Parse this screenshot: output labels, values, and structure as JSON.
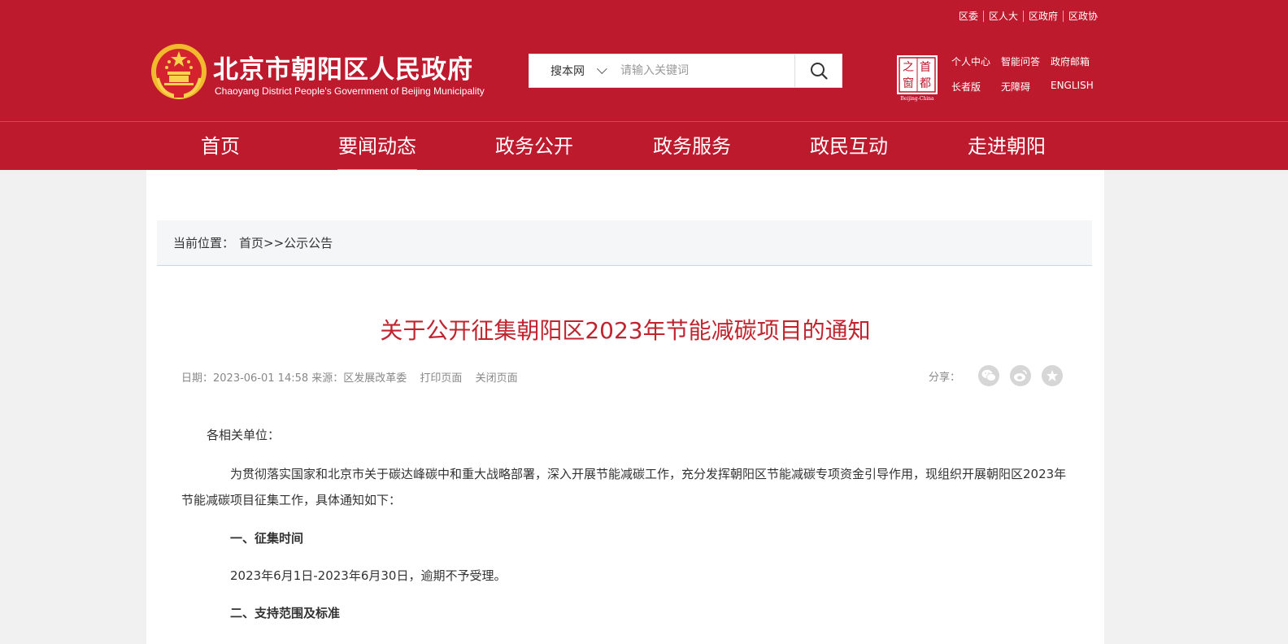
{
  "top_links": [
    "区委",
    "区人大",
    "区政府",
    "区政协"
  ],
  "site": {
    "title": "北京市朝阳区人民政府",
    "subtitle": "Chaoyang District People's Government of Beijing Municipality"
  },
  "search": {
    "scope": "搜本网",
    "placeholder": "请输入关键词"
  },
  "capital_logo": {
    "text_a": "首",
    "text_b": "都",
    "text_c": "之",
    "text_d": "窗",
    "caption": "Beijing-China"
  },
  "quick_links": {
    "row1": [
      "个人中心",
      "智能问答",
      "政府邮箱"
    ],
    "row2": [
      "长者版",
      "无障碍",
      "ENGLISH"
    ]
  },
  "nav": {
    "items": [
      "首页",
      "要闻动态",
      "政务公开",
      "政务服务",
      "政民互动",
      "走进朝阳"
    ],
    "active_index": 1
  },
  "breadcrumb": {
    "label": "当前位置：",
    "path": "首页>>公示公告"
  },
  "article": {
    "title": "关于公开征集朝阳区2023年节能减碳项目的通知",
    "meta": "日期：2023-06-01 14:58 来源：区发展改革委",
    "print": "打印页面",
    "close": "关闭页面",
    "share_label": "分享：",
    "greeting": "各相关单位：",
    "para1": "为贯彻落实国家和北京市关于碳达峰碳中和重大战略部署，深入开展节能减碳工作，充分发挥朝阳区节能减碳专项资金引导作用，现组织开展朝阳区2023年节能减碳项目征集工作，具体通知如下：",
    "heading1": "一、征集时间",
    "para2": "2023年6月1日-2023年6月30日，逾期不予受理。",
    "heading2": "二、支持范围及标准"
  },
  "colors": {
    "brand_red": "#bd1a2d",
    "title_red": "#c0252f",
    "nav_active_underline": "#f4a23c"
  }
}
